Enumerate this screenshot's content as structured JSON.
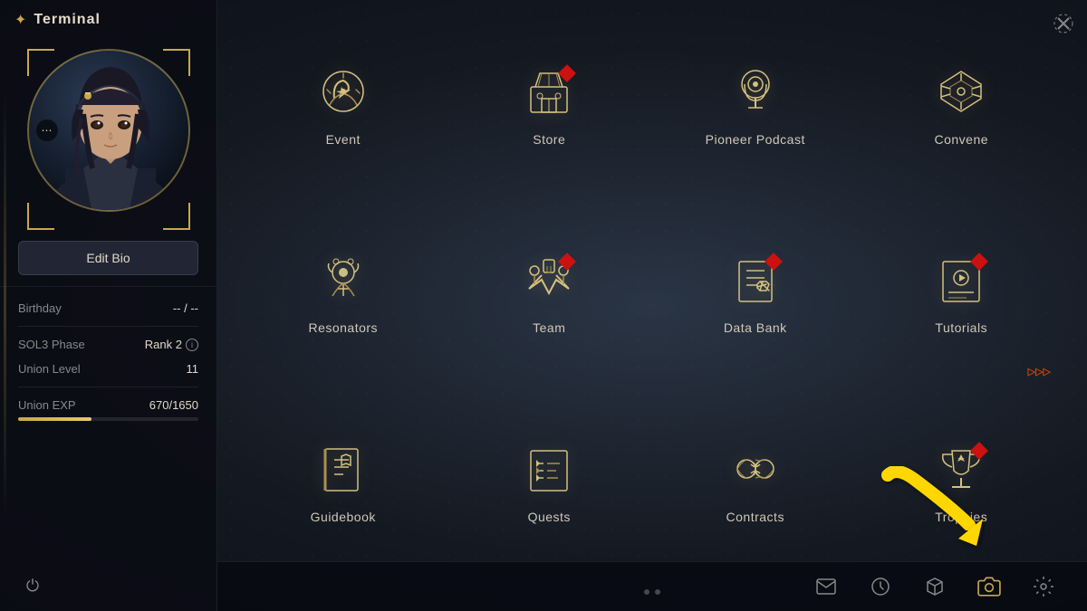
{
  "window": {
    "title": "Terminal"
  },
  "left_panel": {
    "title": "Terminal",
    "edit_bio_label": "Edit Bio",
    "stats": {
      "birthday_label": "Birthday",
      "birthday_value": "-- / --",
      "sol3_label": "SOL3 Phase",
      "sol3_value": "Rank 2",
      "union_level_label": "Union Level",
      "union_level_value": "11",
      "union_exp_label": "Union EXP",
      "union_exp_value": "670/1650",
      "union_exp_fill_pct": 40.6
    }
  },
  "menu_items": [
    {
      "id": "event",
      "label": "Event",
      "icon": "event",
      "badge": false
    },
    {
      "id": "store",
      "label": "Store",
      "icon": "store",
      "badge": true
    },
    {
      "id": "pioneer-podcast",
      "label": "Pioneer Podcast",
      "icon": "podcast",
      "badge": false
    },
    {
      "id": "convene",
      "label": "Convene",
      "icon": "convene",
      "badge": false
    },
    {
      "id": "resonators",
      "label": "Resonators",
      "icon": "resonators",
      "badge": false
    },
    {
      "id": "team",
      "label": "Team",
      "icon": "team",
      "badge": true
    },
    {
      "id": "data-bank",
      "label": "Data Bank",
      "icon": "databank",
      "badge": true
    },
    {
      "id": "tutorials",
      "label": "Tutorials",
      "icon": "tutorials",
      "badge": true,
      "arrows": true
    },
    {
      "id": "guidebook",
      "label": "Guidebook",
      "icon": "guidebook",
      "badge": false
    },
    {
      "id": "quests",
      "label": "Quests",
      "icon": "quests",
      "badge": false
    },
    {
      "id": "contracts",
      "label": "Contracts",
      "icon": "contracts",
      "badge": false
    },
    {
      "id": "trophies",
      "label": "Trophies",
      "icon": "trophies",
      "badge": true
    }
  ],
  "bottom_bar": {
    "icons": [
      "mail",
      "clock",
      "box",
      "camera",
      "settings"
    ]
  },
  "page_dots": [
    {
      "active": false
    },
    {
      "active": false
    }
  ]
}
